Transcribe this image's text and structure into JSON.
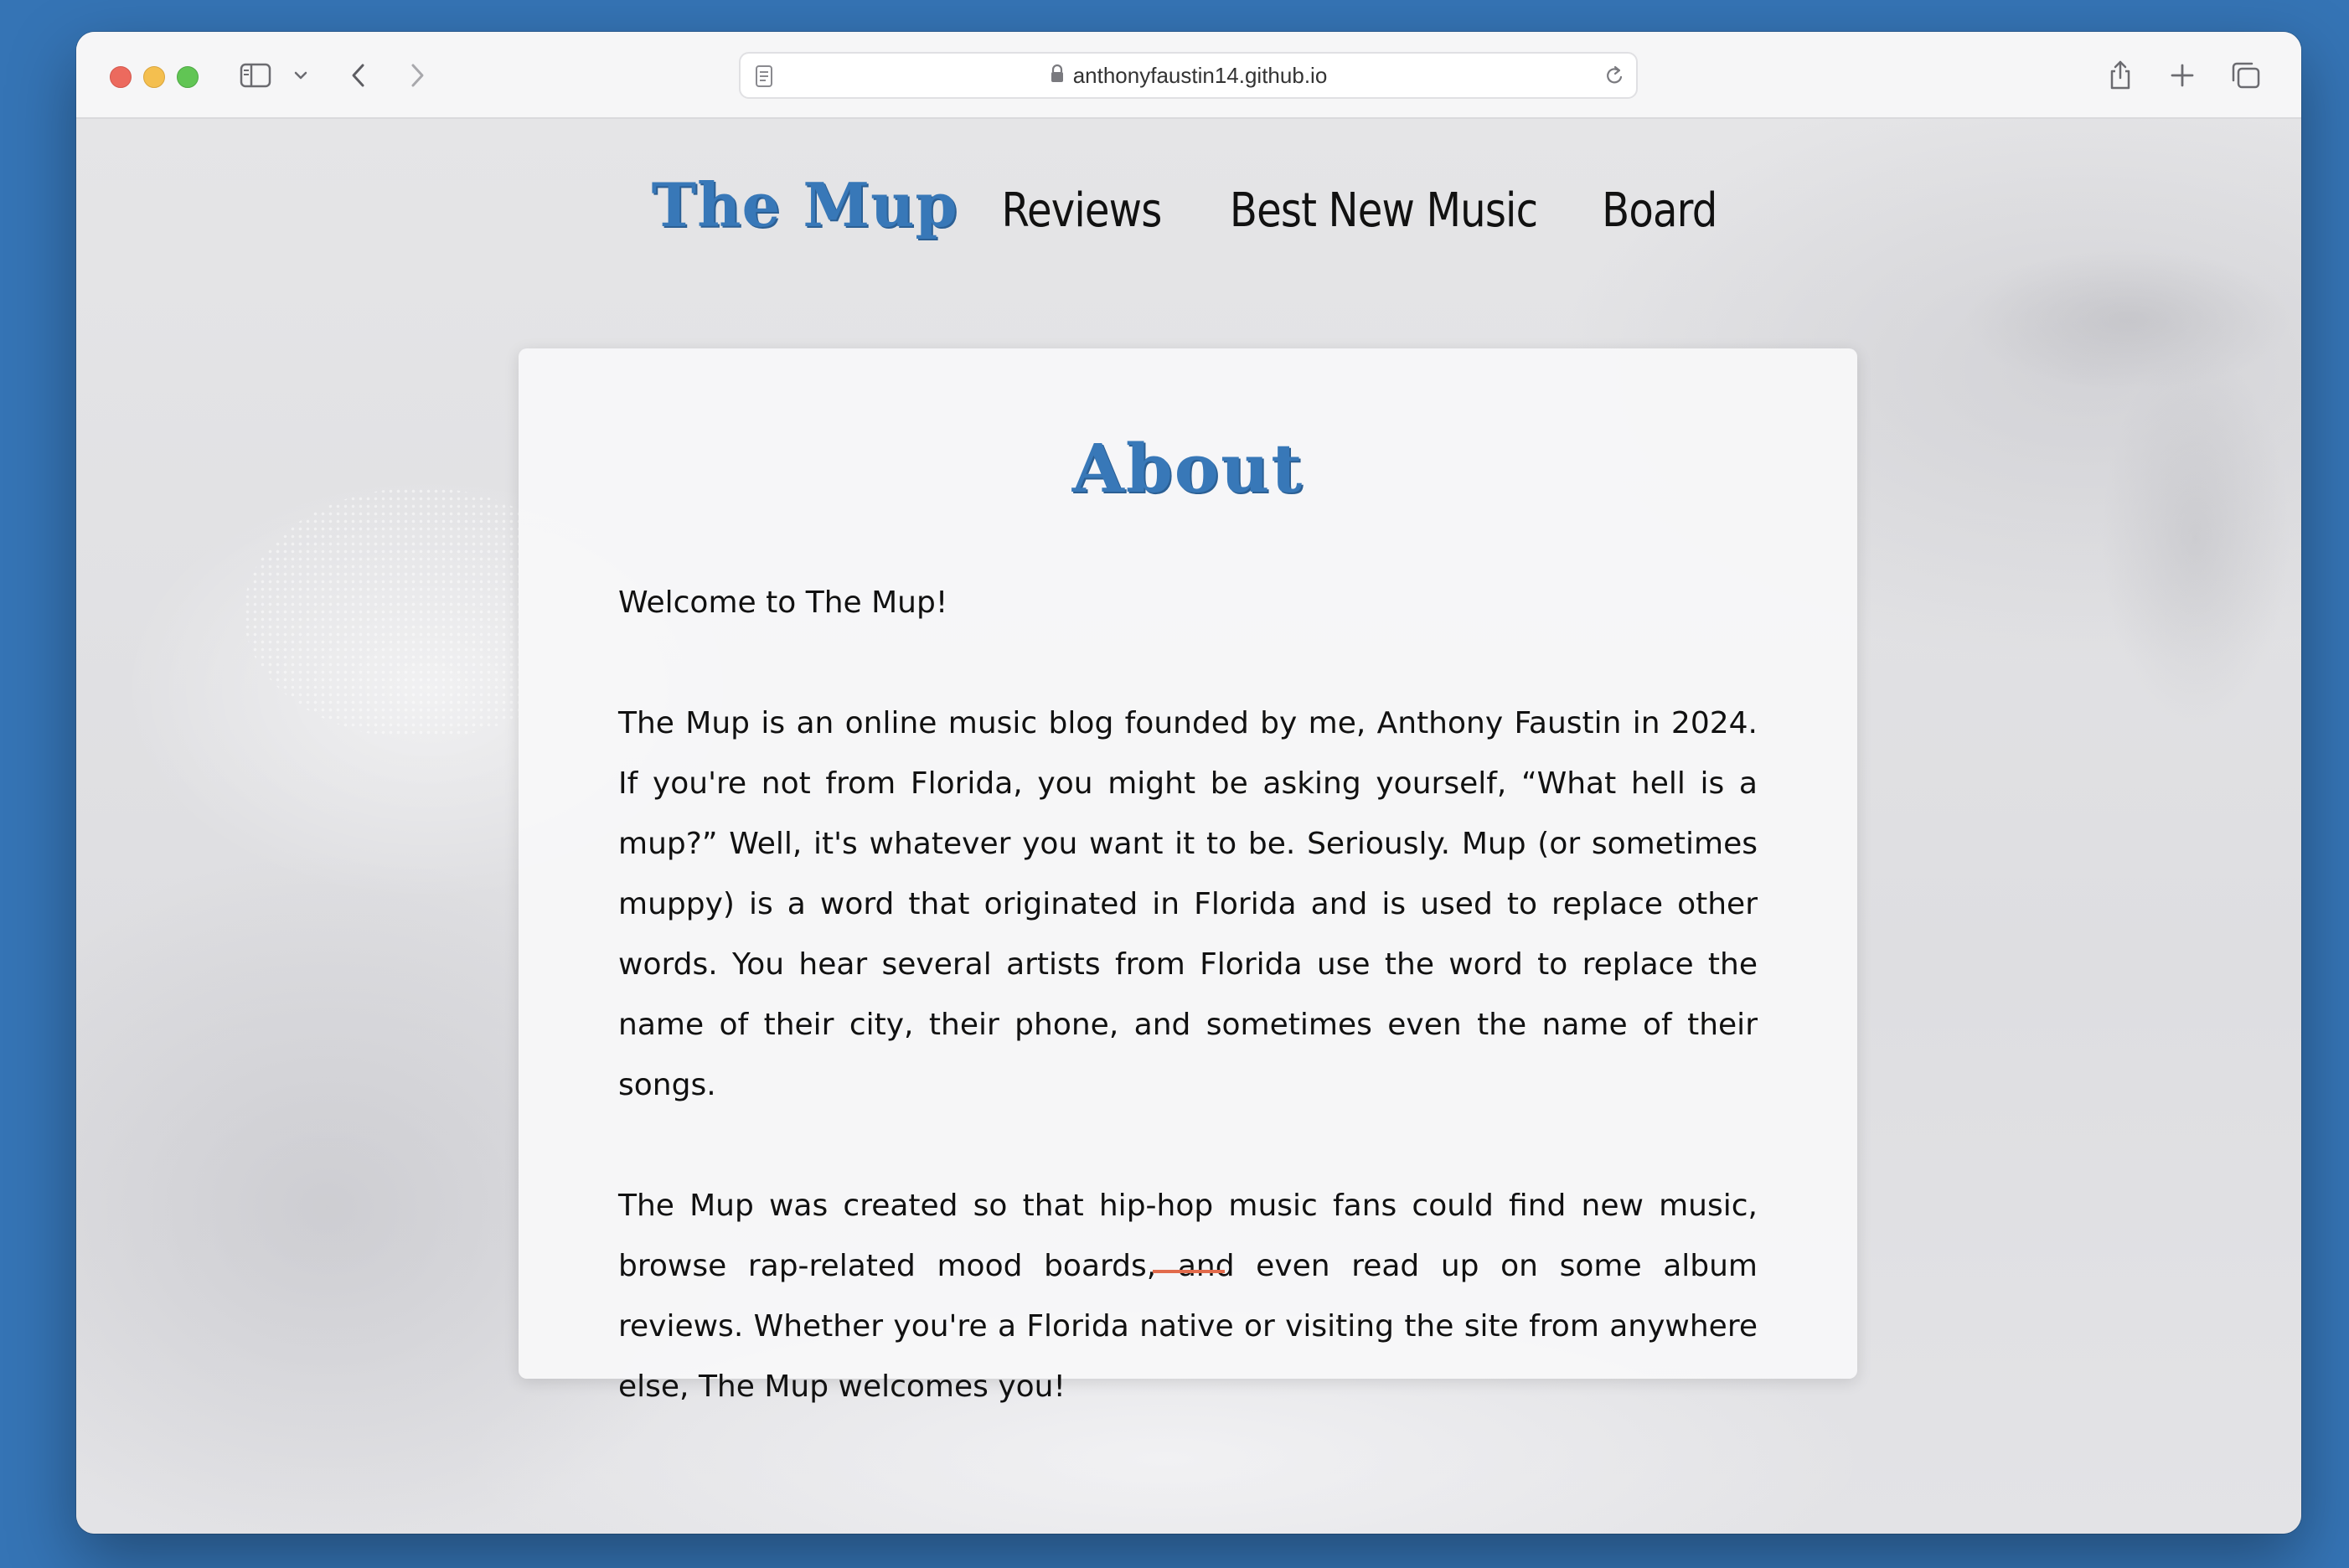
{
  "browser": {
    "url": "anthonyfaustin14.github.io"
  },
  "site": {
    "brand": "The Mup",
    "nav": [
      {
        "label": "Reviews"
      },
      {
        "label": "Best New Music"
      },
      {
        "label": "Board"
      }
    ]
  },
  "about": {
    "title": "About",
    "paragraphs": [
      "Welcome to The Mup!",
      "The Mup is an online music blog founded by me, Anthony Faustin in 2024. If you're not from Florida, you might be asking yourself, “What hell is a mup?” Well, it's whatever you want it to be. Seriously. Mup (or sometimes muppy) is a word that originated in Florida and is used to replace other words. You hear several artists from Florida use the word to replace the name of their city, their phone, and sometimes even the name of their songs.",
      "The Mup was created so that hip-hop music fans could find new music, browse rap-related mood boards, and even read up on some album reviews. Whether you're a Florida native or visiting the site from anywhere else, The Mup welcomes you!"
    ]
  },
  "colors": {
    "accent_blue": "#3878b8",
    "divider_orange": "#e26b4c",
    "desktop_blue": "#3574b5"
  },
  "icons": {
    "toolbar": [
      "sidebar-icon",
      "chevron-down-icon",
      "back-arrow-icon",
      "forward-arrow-icon",
      "share-icon",
      "new-tab-icon",
      "tab-overview-icon"
    ],
    "address": [
      "page-icon",
      "lock-icon",
      "reload-icon"
    ]
  }
}
